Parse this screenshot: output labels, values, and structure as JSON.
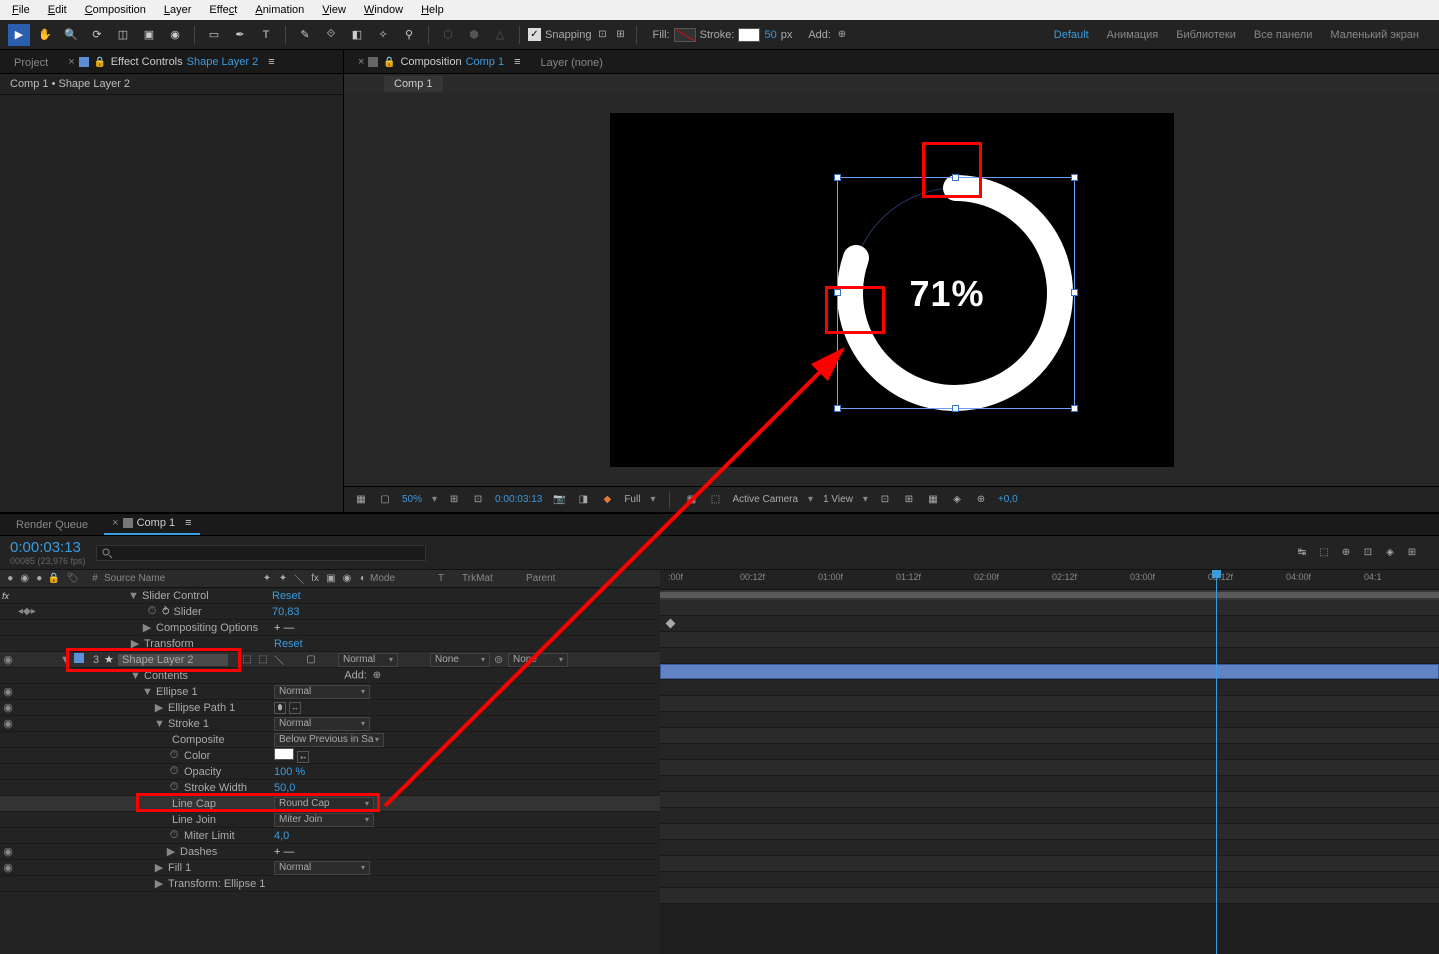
{
  "menubar": [
    "File",
    "Edit",
    "Composition",
    "Layer",
    "Effect",
    "Animation",
    "View",
    "Window",
    "Help"
  ],
  "toolbar": {
    "snapping": "Snapping",
    "fill_label": "Fill:",
    "stroke_label": "Stroke:",
    "stroke_width": "50",
    "stroke_unit": "px",
    "add_label": "Add:"
  },
  "workspaces": {
    "default": "Default",
    "anim": "Анимация",
    "lib": "Библиотеки",
    "all": "Все панели",
    "small": "Маленький экран"
  },
  "left_panel": {
    "project_tab": "Project",
    "fx_tab_prefix": "Effect Controls",
    "fx_tab_layer": "Shape Layer 2",
    "subtitle": "Comp 1 • Shape Layer 2"
  },
  "comp_panel": {
    "tab_prefix": "Composition",
    "comp_name": "Comp 1",
    "layer_none": "Layer (none)",
    "inner_tab": "Comp 1"
  },
  "viewer": {
    "percent_text": "71%",
    "zoom": "50%",
    "timecode": "0:00:03:13",
    "full": "Full",
    "camera": "Active Camera",
    "view_count": "1 View",
    "offset": "+0,0"
  },
  "timeline_tabs": {
    "render_queue": "Render Queue",
    "comp": "Comp 1"
  },
  "timeline_head": {
    "timecode": "0:00:03:13",
    "subframe": "00085 (23,976 fps)",
    "search_placeholder": ""
  },
  "column_head": {
    "source": "Source Name",
    "mode": "Mode",
    "t": "T",
    "trkmat": "TrkMat",
    "parent": "Parent"
  },
  "props": {
    "slider_control": "Slider Control",
    "slider": "Slider",
    "slider_val": "70,83",
    "comp_options": "Compositing Options",
    "transform": "Transform",
    "reset": "Reset",
    "layer_num": "3",
    "layer_name": "Shape Layer 2",
    "normal": "Normal",
    "none": "None",
    "none2": "None",
    "contents": "Contents",
    "add": "Add:",
    "ellipse1": "Ellipse 1",
    "ellipse_path": "Ellipse Path 1",
    "stroke1": "Stroke 1",
    "composite": "Composite",
    "below_prev": "Below Previous in Sa",
    "color": "Color",
    "opacity": "Opacity",
    "opacity_val": "100 %",
    "stroke_width": "Stroke Width",
    "stroke_width_val": "50,0",
    "line_cap": "Line Cap",
    "round_cap": "Round Cap",
    "line_join": "Line Join",
    "miter_join": "Miter Join",
    "miter_limit": "Miter Limit",
    "miter_val": "4,0",
    "dashes": "Dashes",
    "fill1": "Fill 1",
    "transform_ellipse": "Transform: Ellipse 1"
  },
  "ruler": {
    "marks": [
      ":00f",
      "00:12f",
      "01:00f",
      "01:12f",
      "02:00f",
      "02:12f",
      "03:00f",
      "03:12f",
      "04:00f",
      "04:1"
    ]
  },
  "symbols": {
    "fx": "fx",
    "lock": "🔒",
    "eye": "●"
  }
}
